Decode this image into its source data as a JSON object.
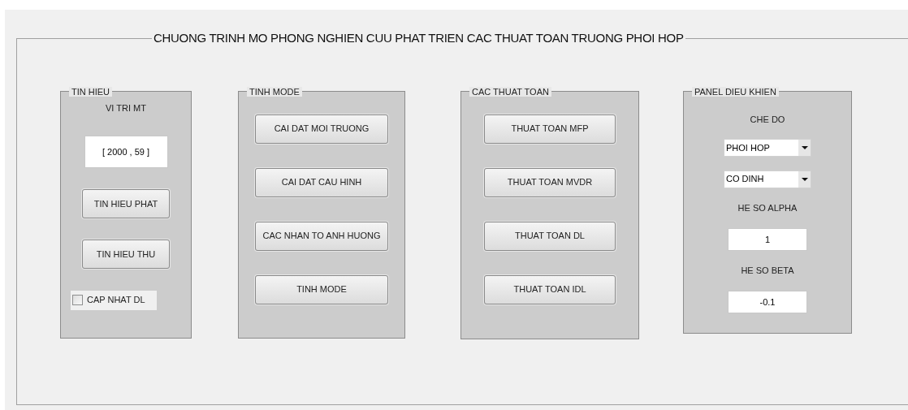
{
  "title": "CHUONG TRINH MO PHONG NGHIEN CUU PHAT TRIEN CAC THUAT TOAN TRUONG PHOI HOP",
  "panels": [
    {
      "title": "TIN HIEU",
      "items": [
        {
          "kind": "label",
          "text": "VI TRI MT"
        },
        {
          "kind": "field",
          "value": "[ 2000 , 59 ]"
        },
        {
          "kind": "button",
          "label": "TIN HIEU PHAT"
        },
        {
          "kind": "button",
          "label": "TIN HIEU THU"
        },
        {
          "kind": "checkbox",
          "label": "CAP NHAT DL",
          "checked": false
        }
      ]
    },
    {
      "title": "TINH MODE",
      "items": [
        {
          "kind": "button",
          "label": "CAI DAT MOI TRUONG"
        },
        {
          "kind": "button",
          "label": "CAI DAT CAU HINH"
        },
        {
          "kind": "button",
          "label": "CAC NHAN TO ANH HUONG"
        },
        {
          "kind": "button",
          "label": "TINH MODE"
        }
      ]
    },
    {
      "title": "CAC THUAT TOAN",
      "items": [
        {
          "kind": "button",
          "label": "THUAT TOAN MFP"
        },
        {
          "kind": "button",
          "label": "THUAT TOAN MVDR"
        },
        {
          "kind": "button",
          "label": "THUAT TOAN DL"
        },
        {
          "kind": "button",
          "label": "THUAT TOAN IDL"
        }
      ]
    },
    {
      "title": "PANEL DIEU KHIEN",
      "items": [
        {
          "kind": "label",
          "text": "CHE DO"
        },
        {
          "kind": "dropdown",
          "value": "PHOI HOP"
        },
        {
          "kind": "dropdown",
          "value": "CO DINH"
        },
        {
          "kind": "label",
          "text": "HE SO ALPHA"
        },
        {
          "kind": "field",
          "value": "1"
        },
        {
          "kind": "label",
          "text": "HE SO BETA"
        },
        {
          "kind": "field",
          "value": "-0.1"
        }
      ]
    }
  ]
}
